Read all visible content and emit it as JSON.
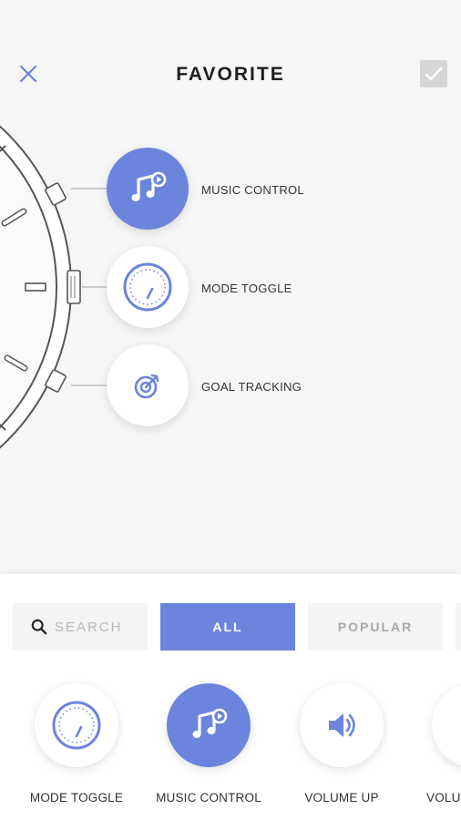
{
  "header": {
    "title": "FAVORITE",
    "close_icon": "close-icon",
    "confirm_icon": "check-icon"
  },
  "slots": [
    {
      "label": "MUSIC CONTROL",
      "icon": "music-control-icon",
      "selected": true
    },
    {
      "label": "MODE TOGGLE",
      "icon": "mode-toggle-icon",
      "selected": false
    },
    {
      "label": "GOAL TRACKING",
      "icon": "goal-tracking-icon",
      "selected": false
    }
  ],
  "filters": {
    "search_placeholder": "SEARCH",
    "tabs": [
      {
        "label": "ALL",
        "active": true
      },
      {
        "label": "POPULAR",
        "active": false
      }
    ]
  },
  "functions": [
    {
      "label": "MODE TOGGLE",
      "icon": "mode-toggle-icon"
    },
    {
      "label": "MUSIC CONTROL",
      "icon": "music-control-icon",
      "selected": true
    },
    {
      "label": "VOLUME UP",
      "icon": "volume-up-icon"
    },
    {
      "label": "VOLU",
      "icon": "volume-down-icon"
    }
  ],
  "colors": {
    "accent": "#6b84dc",
    "background": "#f6f6f6",
    "panel": "#ffffff"
  }
}
